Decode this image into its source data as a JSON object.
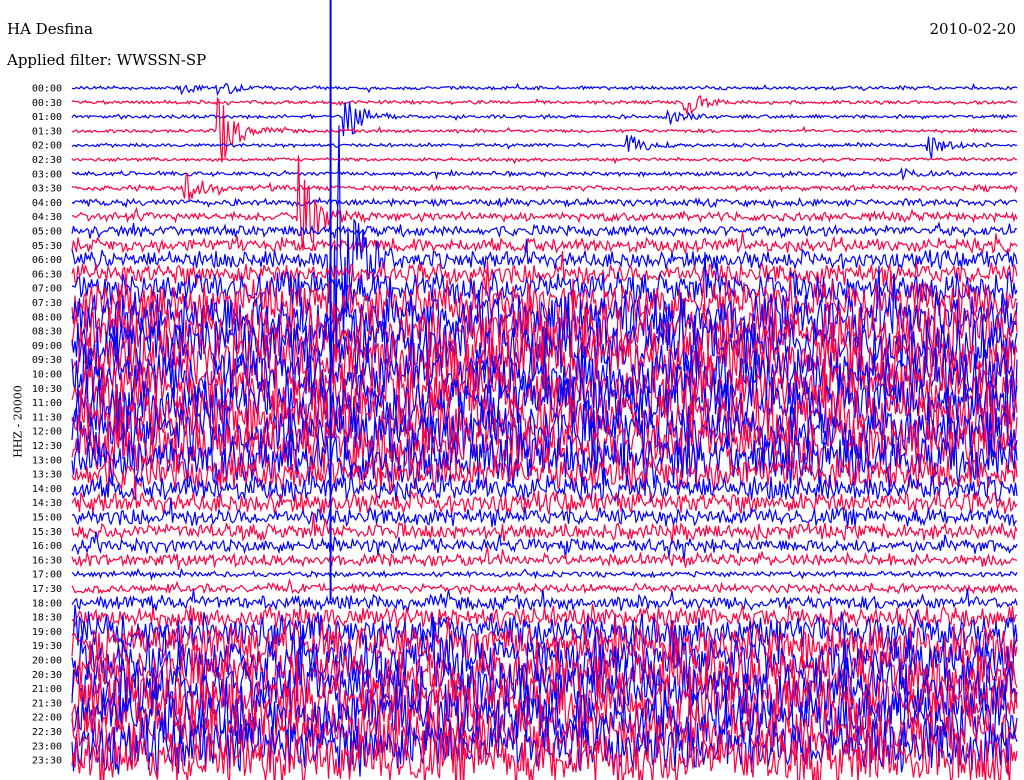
{
  "header": {
    "station": "HA Desfina",
    "filter": "Applied filter: WWSSN-SP",
    "date": "2010-02-20"
  },
  "chart_data": {
    "type": "line",
    "title": "HA Desfina",
    "subtitle": "Applied filter: WWSSN-SP",
    "ylabel": "HHZ - 20000",
    "xlabel": "",
    "minutes_per_line": 30,
    "colors": [
      "#0000ff",
      "#ff0040"
    ],
    "row_labels": [
      "00:00",
      "00:30",
      "01:00",
      "01:30",
      "02:00",
      "02:30",
      "03:00",
      "03:30",
      "04:00",
      "04:30",
      "05:00",
      "05:30",
      "06:00",
      "06:30",
      "07:00",
      "07:30",
      "08:00",
      "08:30",
      "09:00",
      "09:30",
      "10:00",
      "10:30",
      "11:00",
      "11:30",
      "12:00",
      "12:30",
      "13:00",
      "13:30",
      "14:00",
      "14:30",
      "15:00",
      "15:30",
      "16:00",
      "16:30",
      "17:00",
      "17:30",
      "18:00",
      "18:30",
      "19:00",
      "19:30",
      "20:00",
      "20:30",
      "21:00",
      "21:30",
      "22:00",
      "22:30",
      "23:00",
      "23:30"
    ],
    "relative_noise_amplitude": [
      1,
      1,
      1,
      1,
      1,
      1,
      1.2,
      1.5,
      2,
      2.5,
      3,
      4,
      5,
      6,
      9,
      12,
      14,
      15,
      16,
      16,
      16,
      16,
      16,
      16,
      16,
      15,
      14,
      10,
      7,
      6,
      5,
      4.5,
      4,
      3.5,
      1.5,
      2.5,
      4,
      6,
      10,
      12,
      14,
      15,
      16,
      16,
      16,
      16,
      16,
      16
    ],
    "events": [
      {
        "row": 0,
        "minute": 3.5,
        "amplitude": 6
      },
      {
        "row": 0,
        "minute": 4.7,
        "amplitude": 8
      },
      {
        "row": 1,
        "minute": 19.5,
        "amplitude": 14
      },
      {
        "row": 2,
        "minute": 8.7,
        "amplitude": 30
      },
      {
        "row": 2,
        "minute": 18.9,
        "amplitude": 8
      },
      {
        "row": 3,
        "minute": 4.7,
        "amplitude": 40
      },
      {
        "row": 4,
        "minute": 17.7,
        "amplitude": 12
      },
      {
        "row": 4,
        "minute": 27.2,
        "amplitude": 14
      },
      {
        "row": 6,
        "minute": 26.3,
        "amplitude": 6
      },
      {
        "row": 7,
        "minute": 3.6,
        "amplitude": 16
      },
      {
        "row": 9,
        "minute": 7.2,
        "amplitude": 60
      },
      {
        "row": 12,
        "minute": 8.2,
        "amplitude": 260
      }
    ]
  }
}
